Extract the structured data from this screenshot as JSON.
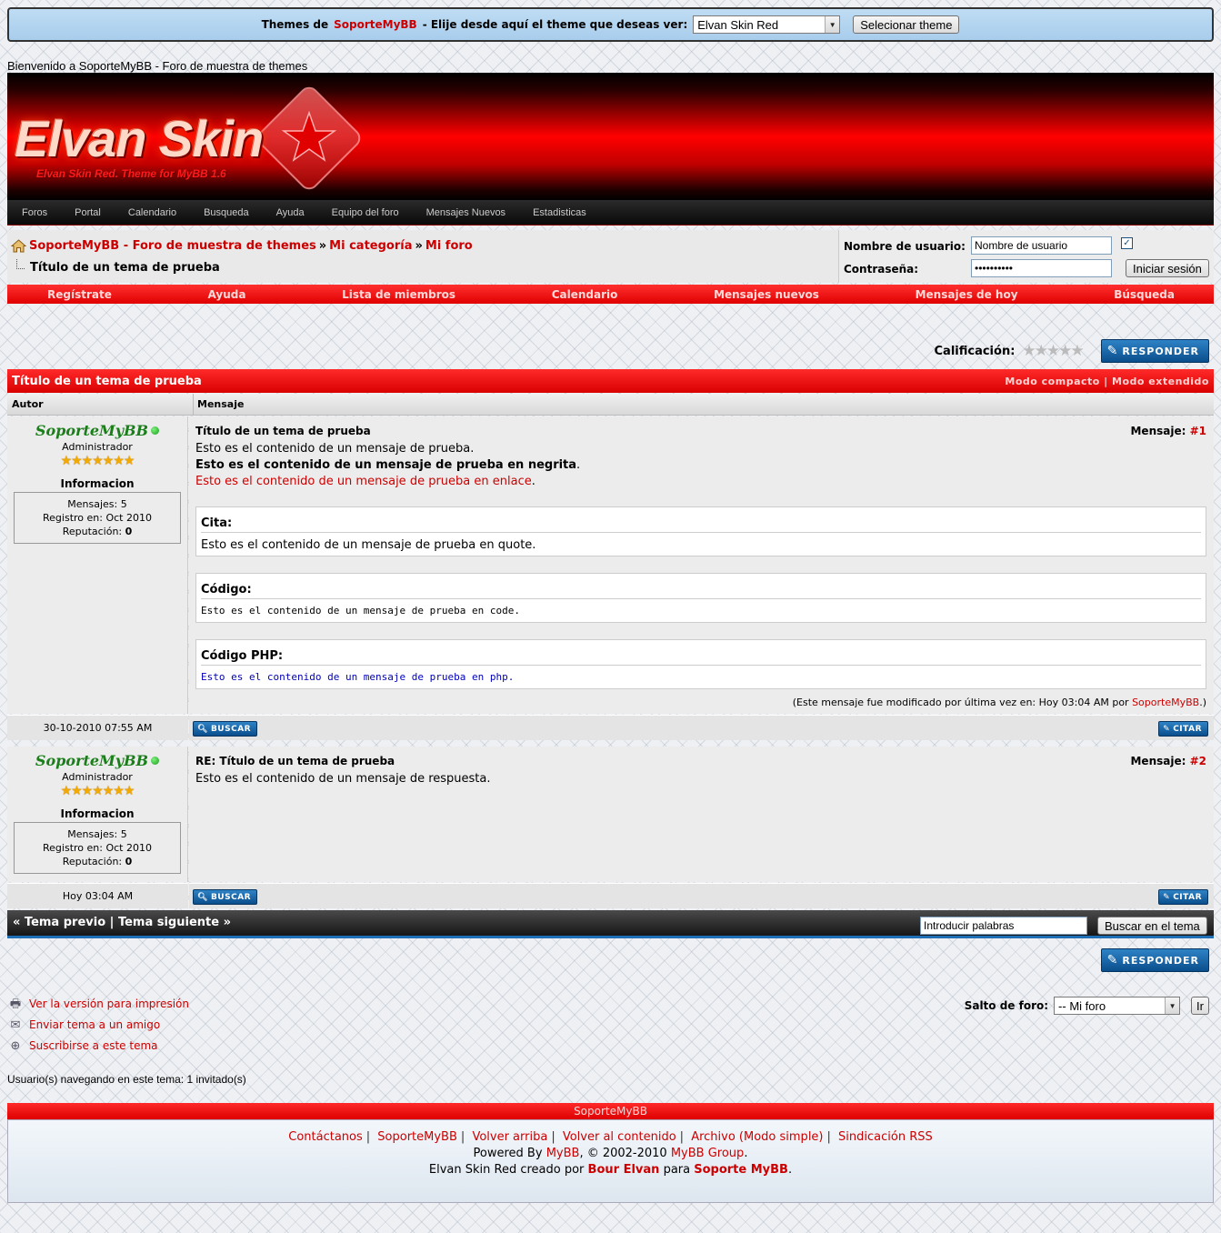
{
  "theme_bar": {
    "prefix": "Themes de",
    "brand": "SoporteMyBB",
    "suffix": "- Elije desde aquí el theme que deseas ver:",
    "selected_theme": "Elvan Skin Red",
    "button": "Selecionar theme"
  },
  "welcome": "Bienvenido a SoporteMyBB - Foro de muestra de themes",
  "header": {
    "logo_text": "Elvan Skin",
    "logo_subtitle": "Elvan Skin Red. Theme for MyBB 1.6"
  },
  "nav_items": [
    "Foros",
    "Portal",
    "Calendario",
    "Busqueda",
    "Ayuda",
    "Equipo del foro",
    "Mensajes Nuevos",
    "Estadisticas"
  ],
  "breadcrumb": {
    "items": [
      "SoporteMyBB - Foro de muestra de themes",
      "Mi categoría",
      "Mi foro"
    ],
    "separator": "»",
    "current": "Título de un tema de prueba"
  },
  "login": {
    "username_label": "Nombre de usuario:",
    "username_value": "Nombre de usuario",
    "password_label": "Contraseña:",
    "password_value": "••••••••••",
    "remember_checked": "✓",
    "button": "Iniciar sesión"
  },
  "red_menu": [
    "Regístrate",
    "Ayuda",
    "Lista de miembros",
    "Calendario",
    "Mensajes nuevos",
    "Mensajes de hoy",
    "Búsqueda"
  ],
  "rating": {
    "label": "Calificación:",
    "stars": "★★★★★",
    "value": 0
  },
  "reply_button": "RESPONDER",
  "thread": {
    "title": "Título de un tema de prueba",
    "mode_compact": "Modo compacto",
    "mode_sep": "|",
    "mode_extended": "Modo extendido",
    "col_author": "Autor",
    "col_message": "Mensaje"
  },
  "posts": [
    {
      "username": "SoporteMyBB",
      "usertitle": "Administrador",
      "userstars": "★★★★★★★",
      "info_title": "Informacion",
      "info_posts": "Mensajes: 5",
      "info_registered": "Registro en: Oct 2010",
      "info_rep_label": "Reputación:",
      "info_rep_value": "0",
      "subject": "Título de un tema de prueba",
      "num_label": "Mensaje:",
      "num": "#1",
      "line_plain": "Esto es el contenido de un mensaje de prueba.",
      "line_bold": "Esto es el contenido de un mensaje de prueba en negrita",
      "line_bold_end": ".",
      "line_link": "Esto es el contenido de un mensaje de prueba en enlace",
      "line_link_end": ".",
      "quote_title": "Cita:",
      "quote_text": "Esto es el contenido de un mensaje de prueba en quote.",
      "code_title": "Código:",
      "code_text": "Esto es el contenido de un mensaje de prueba en code.",
      "php_title": "Código PHP:",
      "php_text": "Esto es el contenido de un mensaje de prueba en php.",
      "edit_prefix": "(Este mensaje fue modificado por última vez en: Hoy 03:04 AM por",
      "edit_user": "SoporteMyBB",
      "edit_suffix": ".)",
      "date": "30-10-2010 07:55 AM",
      "search_btn": "BUSCAR",
      "quote_btn": "CITAR"
    },
    {
      "username": "SoporteMyBB",
      "usertitle": "Administrador",
      "userstars": "★★★★★★★",
      "info_title": "Informacion",
      "info_posts": "Mensajes: 5",
      "info_registered": "Registro en: Oct 2010",
      "info_rep_label": "Reputación:",
      "info_rep_value": "0",
      "subject": "RE: Título de un tema de prueba",
      "num_label": "Mensaje:",
      "num": "#2",
      "line_plain": "Esto es el contenido de un mensaje de respuesta.",
      "date": "Hoy 03:04 AM",
      "search_btn": "BUSCAR",
      "quote_btn": "CITAR"
    }
  ],
  "thread_nav": {
    "prev": "« Tema previo",
    "sep": "|",
    "next": "Tema siguiente »",
    "search_placeholder": "Introducir palabras",
    "search_button": "Buscar en el tema"
  },
  "tools": {
    "print": "Ver la versión para impresión",
    "send": "Enviar tema a un amigo",
    "subscribe": "Suscribirse a este tema"
  },
  "jump": {
    "label": "Salto de foro:",
    "selected": "-- Mi foro",
    "button": "Ir"
  },
  "online": "Usuario(s) navegando en este tema: 1 invitado(s)",
  "footer": {
    "bar_title": "SoporteMyBB",
    "links": [
      "Contáctanos",
      "SoporteMyBB",
      "Volver arriba",
      "Volver al contenido",
      "Archivo (Modo simple)",
      "Sindicación RSS"
    ],
    "powered_prefix": "Powered By",
    "powered_mybb": "MyBB",
    "powered_mid": ", © 2002-2010",
    "powered_group": "MyBB Group",
    "powered_end": ".",
    "credit_prefix": "Elvan Skin Red creado por",
    "credit_author": "Bour Elvan",
    "credit_mid": "para",
    "credit_site": "Soporte MyBB",
    "credit_end": "."
  },
  "colors": {
    "accent_red": "#ff0000",
    "link_red": "#cc0000",
    "username_green": "#1a7f1a",
    "button_blue": "#0a4e8c"
  }
}
